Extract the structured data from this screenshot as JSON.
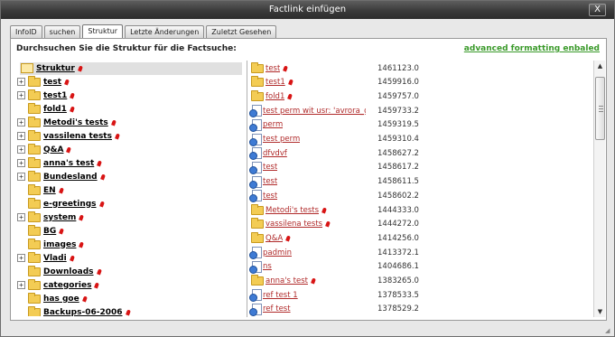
{
  "dialog": {
    "title": "Factlink einfügen",
    "close_label": "X"
  },
  "tabs": [
    {
      "label": "InfoID"
    },
    {
      "label": "suchen"
    },
    {
      "label": "Struktur"
    },
    {
      "label": "Letzte Änderungen"
    },
    {
      "label": "Zuletzt Gesehen"
    }
  ],
  "active_tab": "Struktur",
  "panel": {
    "heading": "Durchsuchen Sie die Struktur für die Factsuche:",
    "advanced_link": "advanced formatting enbaled"
  },
  "tree": {
    "root": "Struktur",
    "items": [
      {
        "label": "test",
        "expandable": true,
        "plus": "+"
      },
      {
        "label": "test1",
        "expandable": true,
        "plus": "+"
      },
      {
        "label": "fold1",
        "expandable": false,
        "plus": ""
      },
      {
        "label": "Metodi's tests",
        "expandable": true,
        "plus": "+"
      },
      {
        "label": "vassilena tests",
        "expandable": true,
        "plus": "+"
      },
      {
        "label": "Q&A",
        "expandable": true,
        "plus": "+"
      },
      {
        "label": "anna's test",
        "expandable": true,
        "plus": "+"
      },
      {
        "label": "Bundesland",
        "expandable": true,
        "plus": "+"
      },
      {
        "label": "EN",
        "expandable": false,
        "plus": ""
      },
      {
        "label": "e-greetings",
        "expandable": false,
        "plus": ""
      },
      {
        "label": "system",
        "expandable": true,
        "plus": "+"
      },
      {
        "label": "BG",
        "expandable": false,
        "plus": ""
      },
      {
        "label": "images",
        "expandable": false,
        "plus": ""
      },
      {
        "label": "Vladi",
        "expandable": true,
        "plus": "+"
      },
      {
        "label": "Downloads",
        "expandable": false,
        "plus": ""
      },
      {
        "label": "categories",
        "expandable": true,
        "plus": "+"
      },
      {
        "label": "has goe",
        "expandable": false,
        "plus": ""
      },
      {
        "label": "Backups-06-2006",
        "expandable": false,
        "plus": ""
      }
    ]
  },
  "results": [
    {
      "icon": "folder-icon",
      "label": "test",
      "pin": true,
      "id": "1461123.0"
    },
    {
      "icon": "folder-icon",
      "label": "test1",
      "pin": true,
      "id": "1459916.0"
    },
    {
      "icon": "folder-icon",
      "label": "fold1",
      "pin": true,
      "id": "1459757.0"
    },
    {
      "icon": "document-icon",
      "label": "test perm wit usr: 'avrora_gea'",
      "pin": false,
      "id": "1459733.2"
    },
    {
      "icon": "document-icon",
      "label": "perm",
      "pin": false,
      "id": "1459319.5"
    },
    {
      "icon": "document-icon",
      "label": "test perm",
      "pin": false,
      "id": "1459310.4"
    },
    {
      "icon": "document-icon",
      "label": "dfvdvf",
      "pin": false,
      "id": "1458627.2"
    },
    {
      "icon": "document-icon",
      "label": "test",
      "pin": false,
      "id": "1458617.2"
    },
    {
      "icon": "document-icon",
      "label": "test",
      "pin": false,
      "id": "1458611.5"
    },
    {
      "icon": "document-icon",
      "label": "test",
      "pin": false,
      "id": "1458602.2"
    },
    {
      "icon": "folder-icon",
      "label": "Metodi's tests",
      "pin": true,
      "id": "1444333.0"
    },
    {
      "icon": "folder-icon",
      "label": "vassilena tests",
      "pin": true,
      "id": "1444272.0"
    },
    {
      "icon": "folder-icon",
      "label": "Q&A",
      "pin": true,
      "id": "1414256.0"
    },
    {
      "icon": "document-icon",
      "label": "padmin",
      "pin": false,
      "id": "1413372.1"
    },
    {
      "icon": "document-icon",
      "label": "ns",
      "pin": false,
      "id": "1404686.1"
    },
    {
      "icon": "folder-icon",
      "label": "anna's test",
      "pin": true,
      "id": "1383265.0"
    },
    {
      "icon": "document-icon",
      "label": "ref test 1",
      "pin": false,
      "id": "1378533.5"
    },
    {
      "icon": "document-icon",
      "label": "ref test",
      "pin": false,
      "id": "1378529.2"
    }
  ],
  "scrollbar": {
    "up_arrow": "▲",
    "down_arrow": "▼"
  }
}
